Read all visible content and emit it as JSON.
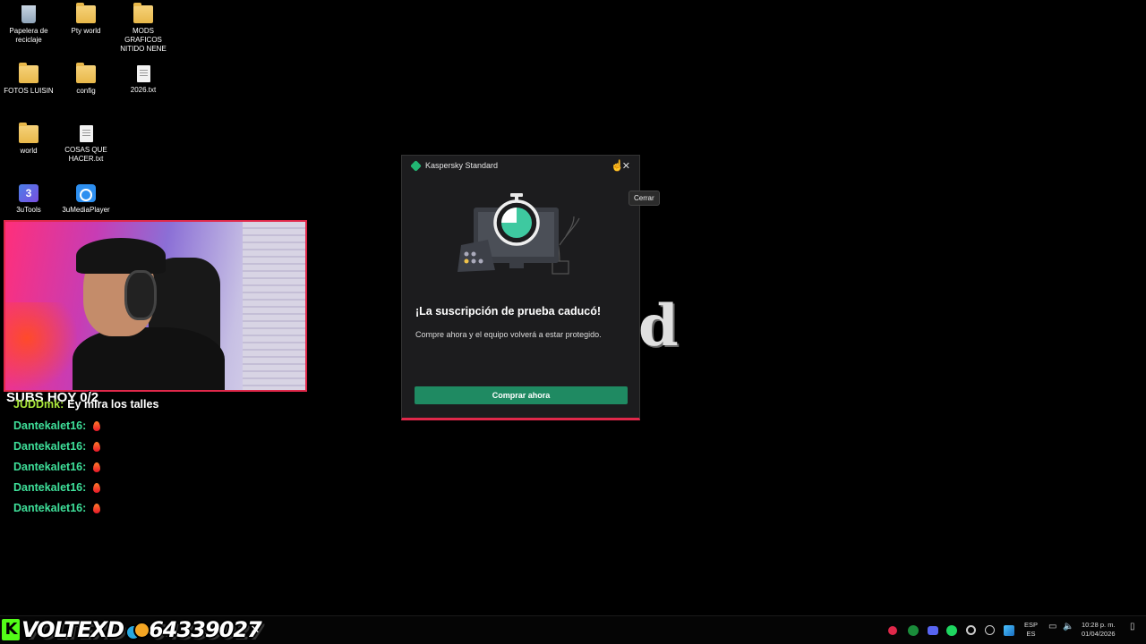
{
  "desktop": {
    "icons": [
      {
        "label": "Papelera de reciclaje",
        "icon": "recycle-bin-icon"
      },
      {
        "label": "Pty world",
        "icon": "folder-icon"
      },
      {
        "label": "MODS GRAFICOS NITIDO NENE",
        "icon": "folder-icon"
      },
      {
        "label": "FOTOS LUISIN",
        "icon": "folder-icon"
      },
      {
        "label": "config",
        "icon": "folder-icon"
      },
      {
        "label": "2026.txt",
        "icon": "text-file-icon"
      },
      {
        "label": "world",
        "icon": "folder-icon"
      },
      {
        "label": "COSAS QUE HACER.txt",
        "icon": "text-file-icon"
      },
      {
        "label": "3uTools",
        "icon": "3utools-icon"
      },
      {
        "label": "3uMediaPlayer",
        "icon": "3umediaplayer-icon"
      }
    ]
  },
  "overlay": {
    "subs_counter": "SUBS HOY 0/2",
    "chat": [
      {
        "user": "JUDDmk:",
        "message": "Ey mira los talles"
      },
      {
        "user": "Dantekalet16:",
        "message": ""
      },
      {
        "user": "Dantekalet16:",
        "message": ""
      },
      {
        "user": "Dantekalet16:",
        "message": ""
      },
      {
        "user": "Dantekalet16:",
        "message": ""
      },
      {
        "user": "Dantekalet16:",
        "message": ""
      }
    ],
    "streamer_name": "VOLTEXD",
    "points": "64339027"
  },
  "dialog": {
    "title": "Kaspersky Standard",
    "close_glyph": "✕",
    "tooltip": "Cerrar",
    "heading": "¡La suscripción de prueba caducó!",
    "body": "Compre ahora y el equipo volverá a estar protegido.",
    "button": "Comprar ahora"
  },
  "taskbar": {
    "language_line1": "ESP",
    "language_line2": "ES",
    "time": "10:28 p. m.",
    "date": "01/04/2026"
  },
  "colors": {
    "kaspersky_green": "#1f8a62",
    "accent_red": "#e0284a",
    "chat_user": "#3fe09a"
  }
}
